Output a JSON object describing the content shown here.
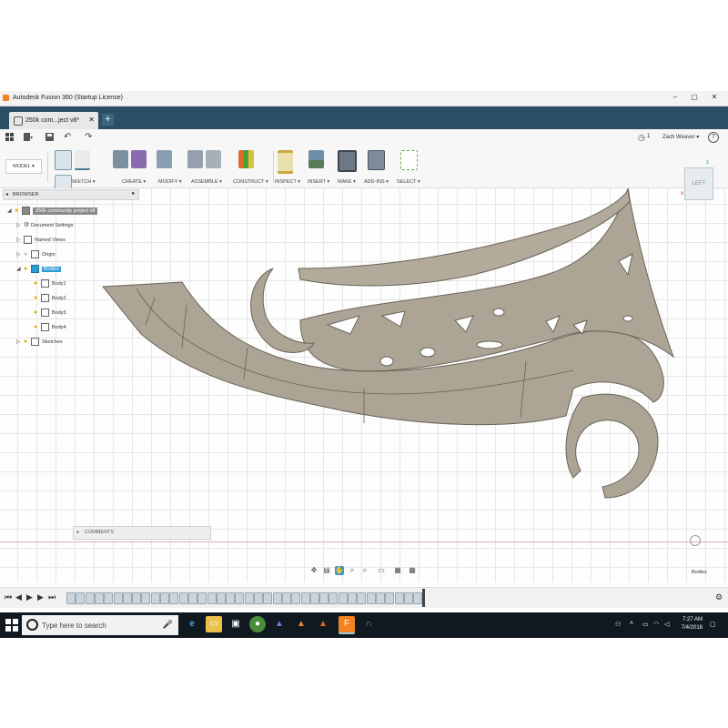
{
  "app": {
    "title": "Autodesk Fusion 360 (Startup License)",
    "window_controls": [
      "–",
      "▢",
      "✕"
    ]
  },
  "tabs": {
    "active": "250k com...ject v8*",
    "close_glyph": "✕",
    "new_tab_glyph": "+"
  },
  "quickbar": {
    "user": "Zach Weaver ▾",
    "help_glyph": "?",
    "job_count": "1"
  },
  "toolbar": {
    "workspace": "MODEL ▾",
    "groups": [
      "SKETCH ▾",
      "CREATE ▾",
      "MODIFY ▾",
      "ASSEMBLE ▾",
      "CONSTRUCT ▾",
      "INSPECT ▾",
      "INSERT ▾",
      "MAKE ▾",
      "ADD-INS ▾",
      "SELECT ▾"
    ]
  },
  "browser": {
    "title": "BROWSER",
    "root": "250k community project v8",
    "items": [
      "Document Settings",
      "Named Views",
      "Origin",
      "Bodies",
      "Body1",
      "Body2",
      "Body3",
      "Body4",
      "Sketches"
    ]
  },
  "comments": {
    "label": "COMMENTS"
  },
  "viewcube": {
    "face": "LEFT"
  },
  "status": {
    "selection": "Bodies"
  },
  "taskbar": {
    "search_placeholder": "Type here to search",
    "time": "7:27 AM",
    "date": "7/4/2018"
  },
  "colors": {
    "tab_bar": "#2d4f65",
    "taskbar": "#101820",
    "model_fill": "#aca494",
    "selection": "#2f9bd8"
  }
}
